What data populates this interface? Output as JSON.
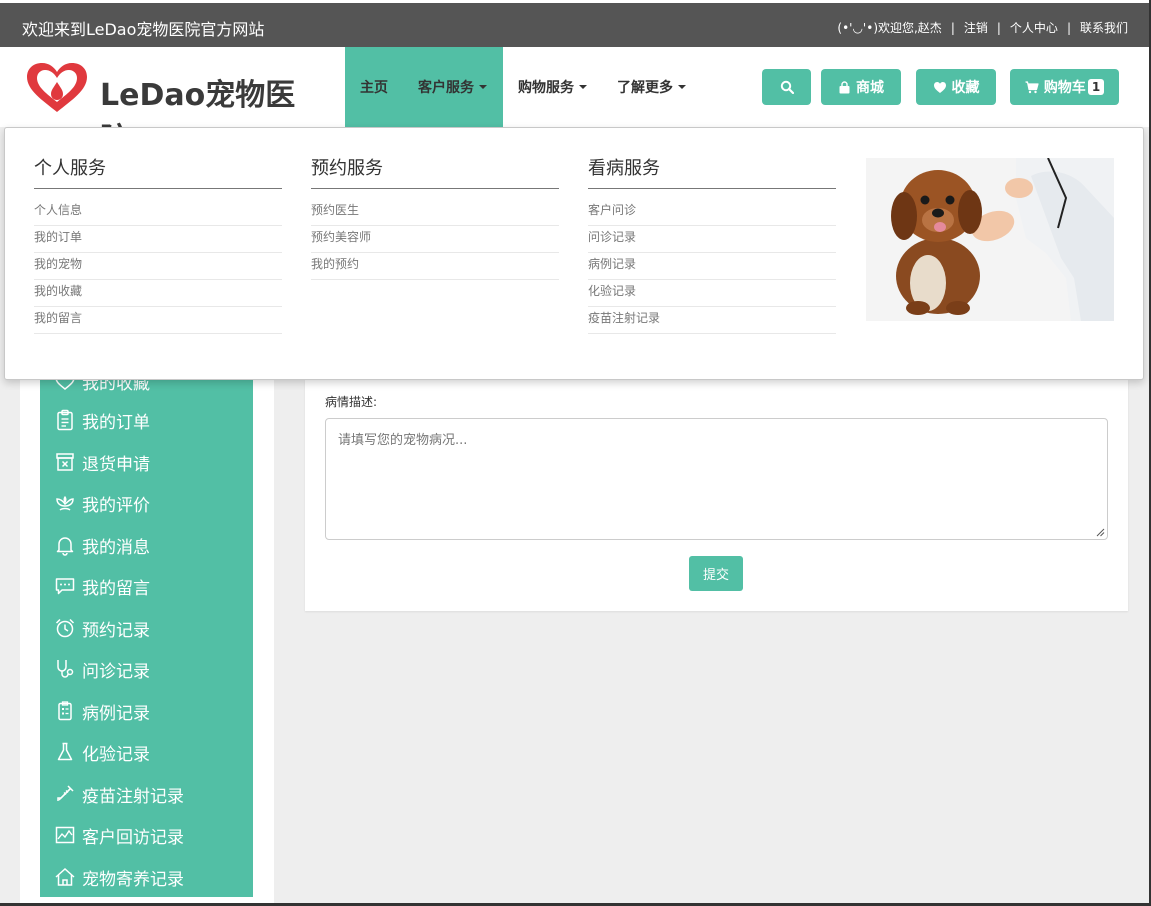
{
  "topbar": {
    "welcome": "欢迎来到LeDao宠物医院官方网站",
    "greeting": "(•'◡'•)欢迎您,赵杰",
    "logout": "注销",
    "personal_center": "个人中心",
    "contact": "联系我们",
    "separator": "|"
  },
  "header": {
    "logo_text": "LeDao宠物医院",
    "nav": {
      "home": "主页",
      "customer_service": "客户服务",
      "shopping_service": "购物服务",
      "learn_more": "了解更多"
    },
    "buttons": {
      "shop": "商城",
      "favorites": "收藏",
      "cart": "购物车",
      "cart_count": "1"
    }
  },
  "mega_menu": {
    "personal": {
      "title": "个人服务",
      "items": [
        "个人信息",
        "我的订单",
        "我的宠物",
        "我的收藏",
        "我的留言"
      ]
    },
    "booking": {
      "title": "预约服务",
      "items": [
        "预约医生",
        "预约美容师",
        "我的预约"
      ]
    },
    "medical": {
      "title": "看病服务",
      "items": [
        "客户问诊",
        "问诊记录",
        "病例记录",
        "化验记录",
        "疫苗注射记录"
      ]
    }
  },
  "sidebar": {
    "items": [
      {
        "label": "我的收藏",
        "icon": "heart-outline-icon"
      },
      {
        "label": "我的订单",
        "icon": "clipboard-icon"
      },
      {
        "label": "退货申请",
        "icon": "return-box-icon"
      },
      {
        "label": "我的评价",
        "icon": "flower-icon"
      },
      {
        "label": "我的消息",
        "icon": "bell-icon"
      },
      {
        "label": "我的留言",
        "icon": "chat-icon"
      },
      {
        "label": "预约记录",
        "icon": "alarm-clock-icon"
      },
      {
        "label": "问诊记录",
        "icon": "stethoscope-icon"
      },
      {
        "label": "病例记录",
        "icon": "medical-record-icon"
      },
      {
        "label": "化验记录",
        "icon": "flask-icon"
      },
      {
        "label": "疫苗注射记录",
        "icon": "syringe-icon"
      },
      {
        "label": "客户回访记录",
        "icon": "chart-icon"
      },
      {
        "label": "宠物寄养记录",
        "icon": "house-icon"
      }
    ]
  },
  "form": {
    "label": "病情描述:",
    "placeholder": "请填写您的宠物病况...",
    "submit": "提交"
  },
  "colors": {
    "accent": "#52bfa5",
    "topbar": "#555555",
    "logo_red": "#e0393e"
  }
}
